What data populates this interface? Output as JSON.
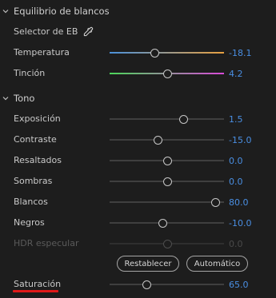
{
  "wb_section": {
    "title": "Equilibrio de blancos",
    "chevron_icon": "chevron-down-icon"
  },
  "wb_selector": {
    "label": "Selector de EB",
    "icon": "eyedropper-icon"
  },
  "temperatura": {
    "label": "Temperatura",
    "value": "-18.1",
    "level": 0.4,
    "gradient": [
      "#4a90d9",
      "#e8a040"
    ]
  },
  "tincion": {
    "label": "Tinción",
    "value": "4.2",
    "level": 0.51,
    "gradient": [
      "#4cd65a",
      "#d94ad9"
    ]
  },
  "tono_section": {
    "title": "Tono",
    "chevron_icon": "chevron-down-icon"
  },
  "exposicion": {
    "label": "Exposición",
    "value": "1.5",
    "level": 0.65
  },
  "contraste": {
    "label": "Contraste",
    "value": "-15.0",
    "level": 0.43
  },
  "resaltados": {
    "label": "Resaltados",
    "value": "0.0",
    "level": 0.51
  },
  "sombras": {
    "label": "Sombras",
    "value": "0.0",
    "level": 0.51
  },
  "blancos": {
    "label": "Blancos",
    "value": "80.0",
    "level": 0.93
  },
  "negros": {
    "label": "Negros",
    "value": "-10.0",
    "level": 0.47
  },
  "hdr": {
    "label": "HDR especular",
    "value": "0.0",
    "level": 0.51,
    "disabled": true
  },
  "buttons": {
    "reset": "Restablecer",
    "auto": "Automático"
  },
  "saturacion": {
    "label": "Saturación",
    "value": "65.0",
    "level": 0.33
  },
  "colors": {
    "accent_value": "#4a8fe3",
    "annotation_underline": "#e01919"
  }
}
